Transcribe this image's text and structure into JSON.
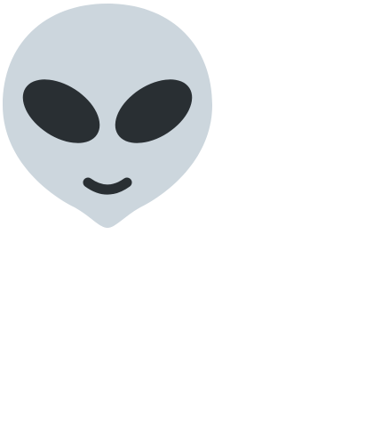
{
  "image": {
    "icon": "alien-face-icon",
    "colors": {
      "background": "#ffffff",
      "head": "#CCD6DD",
      "features": "#292F33"
    }
  }
}
